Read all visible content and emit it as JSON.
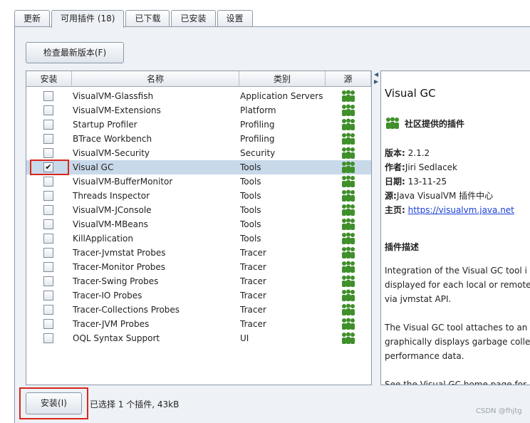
{
  "tabs": [
    {
      "label": "更新",
      "active": false
    },
    {
      "label": "可用插件 (18)",
      "active": true
    },
    {
      "label": "已下载",
      "active": false
    },
    {
      "label": "已安装",
      "active": false
    },
    {
      "label": "设置",
      "active": false
    }
  ],
  "toolbar": {
    "check_label": "检查最新版本(F)"
  },
  "table": {
    "headers": {
      "install": "安装",
      "name": "名称",
      "category": "类别",
      "source": "源"
    },
    "rows": [
      {
        "name": "VisualVM-Glassfish",
        "category": "Application Servers",
        "checked": false,
        "selected": false
      },
      {
        "name": "VisualVM-Extensions",
        "category": "Platform",
        "checked": false,
        "selected": false
      },
      {
        "name": "Startup Profiler",
        "category": "Profiling",
        "checked": false,
        "selected": false
      },
      {
        "name": "BTrace Workbench",
        "category": "Profiling",
        "checked": false,
        "selected": false
      },
      {
        "name": "VisualVM-Security",
        "category": "Security",
        "checked": false,
        "selected": false
      },
      {
        "name": "Visual GC",
        "category": "Tools",
        "checked": true,
        "selected": true
      },
      {
        "name": "VisualVM-BufferMonitor",
        "category": "Tools",
        "checked": false,
        "selected": false
      },
      {
        "name": "Threads Inspector",
        "category": "Tools",
        "checked": false,
        "selected": false
      },
      {
        "name": "VisualVM-JConsole",
        "category": "Tools",
        "checked": false,
        "selected": false
      },
      {
        "name": "VisualVM-MBeans",
        "category": "Tools",
        "checked": false,
        "selected": false
      },
      {
        "name": "KillApplication",
        "category": "Tools",
        "checked": false,
        "selected": false
      },
      {
        "name": "Tracer-Jvmstat Probes",
        "category": "Tracer",
        "checked": false,
        "selected": false
      },
      {
        "name": "Tracer-Monitor Probes",
        "category": "Tracer",
        "checked": false,
        "selected": false
      },
      {
        "name": "Tracer-Swing Probes",
        "category": "Tracer",
        "checked": false,
        "selected": false
      },
      {
        "name": "Tracer-IO Probes",
        "category": "Tracer",
        "checked": false,
        "selected": false
      },
      {
        "name": "Tracer-Collections Probes",
        "category": "Tracer",
        "checked": false,
        "selected": false
      },
      {
        "name": "Tracer-JVM Probes",
        "category": "Tracer",
        "checked": false,
        "selected": false
      },
      {
        "name": "OQL Syntax Support",
        "category": "UI",
        "checked": false,
        "selected": false
      }
    ],
    "check_mark": "✔",
    "source_icon": "community-users-icon"
  },
  "detail": {
    "title": "Visual GC",
    "community_label": "社区提供的插件",
    "version_label": "版本:",
    "version_value": "2.1.2",
    "author_label": "作者:",
    "author_value": "Jiri Sedlacek",
    "date_label": "日期:",
    "date_value": "13-11-25",
    "source_label": "源:",
    "source_value": "Java VisualVM 插件中心",
    "homepage_label": "主页:",
    "homepage_value": "https://visualvm.java.net",
    "desc_heading": "插件描述",
    "desc_lines": [
      "Integration of the Visual GC tool i",
      "displayed for each local or remote",
      "via jvmstat API.",
      "",
      "The Visual GC tool attaches to an",
      "graphically displays garbage colle",
      "performance data.",
      "",
      "See the Visual GC home page for"
    ]
  },
  "footer": {
    "install_label": "安装(I)",
    "status": "已选择 1 个插件, 43kB"
  },
  "watermark": "CSDN @fhjtg",
  "colors": {
    "highlight": "#d9261c",
    "selected_row": "#c8d9ea",
    "link": "#1a3fd6",
    "icon_green": "#3f8f2a"
  }
}
